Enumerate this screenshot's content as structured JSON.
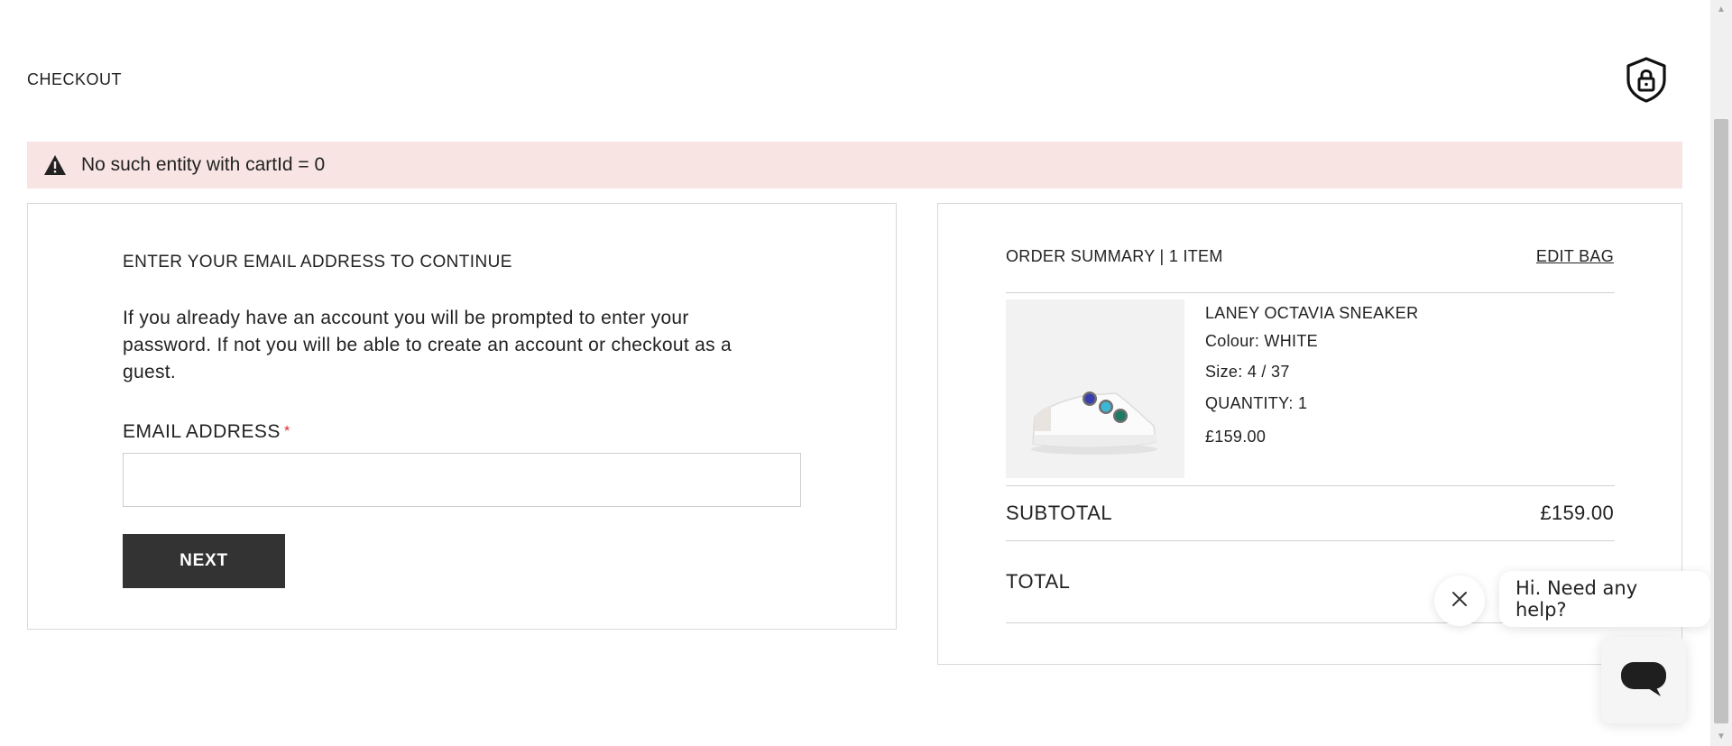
{
  "header": {
    "title": "CHECKOUT",
    "lock_icon": "shield-lock-icon"
  },
  "alert": {
    "icon": "warning-icon",
    "message": "No such entity with cartId = 0",
    "background": "#f8e4e3"
  },
  "email_step": {
    "heading": "ENTER YOUR EMAIL ADDRESS TO CONTINUE",
    "description": "If you already have an account you will be prompted to enter your password. If not you will be able to create an account or checkout as a guest.",
    "label": "EMAIL ADDRESS",
    "required_mark": "*",
    "input_value": "",
    "next_label": "NEXT"
  },
  "summary": {
    "title": "ORDER SUMMARY | 1 ITEM",
    "edit_label": "EDIT BAG",
    "item": {
      "name": "LANEY OCTAVIA SNEAKER",
      "colour": "Colour: WHITE",
      "size": "Size: 4 / 37",
      "quantity": "QUANTITY: 1",
      "price": "£159.00"
    },
    "subtotal_label": "SUBTOTAL",
    "subtotal_value": "£159.00",
    "total_label": "TOTAL"
  },
  "chat": {
    "greeting": "Hi. Need any help?",
    "close_icon": "close-icon",
    "launcher_icon": "chat-icon"
  },
  "colors": {
    "button": "#333333",
    "required": "#d9262b",
    "border": "#d8d8d8"
  }
}
